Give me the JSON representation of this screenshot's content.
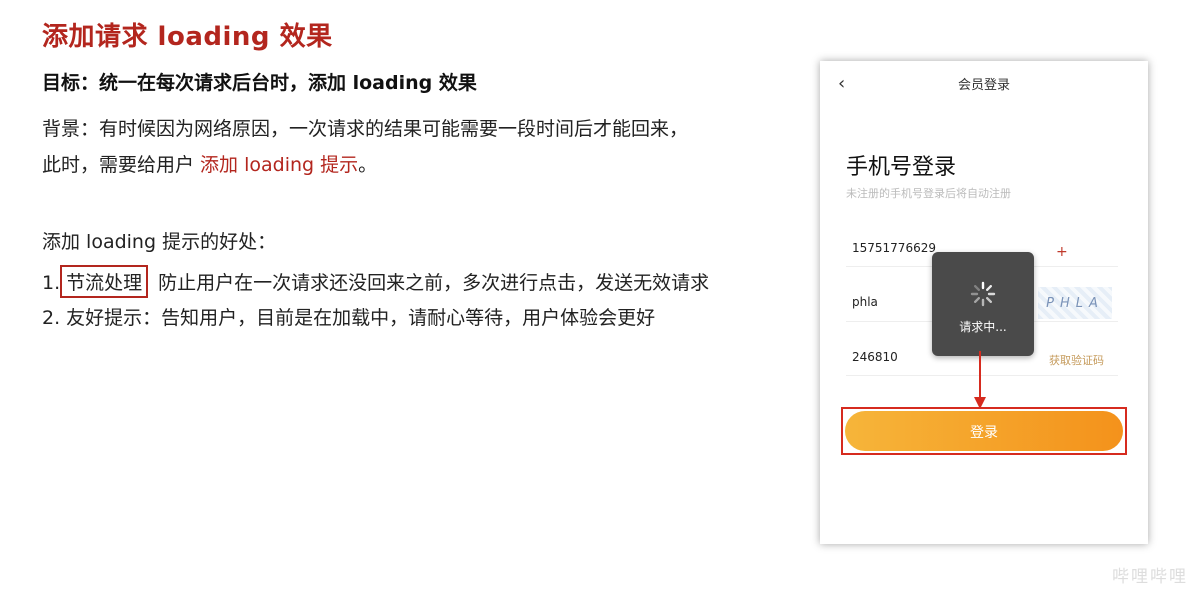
{
  "slide": {
    "title": "添加请求 loading 效果",
    "goal": "目标：统一在每次请求后台时，添加 loading 效果",
    "background_line1": "背景：有时候因为网络原因，一次请求的结果可能需要一段时间后才能回来，",
    "background_line2_prefix": "此时，需要给用户 ",
    "background_line2_highlight": "添加 loading 提示",
    "background_line2_suffix": "。",
    "benefits_title": "添加 loading 提示的好处：",
    "item1_num": "1.",
    "item1_boxed": "节流处理",
    "item1_text": "防止用户在一次请求还没回来之前，多次进行点击，发送无效请求",
    "item2_text": "2. 友好提示：告知用户，目前是在加载中，请耐心等待，用户体验会更好"
  },
  "phone": {
    "back_glyph": "‹",
    "header_title": "会员登录",
    "heading": "手机号登录",
    "subheading": "未注册的手机号登录后将自动注册",
    "phone_value": "15751776629",
    "plus": "+",
    "captcha_value": "phla",
    "captcha_image_text": "PHLA",
    "code_value": "246810",
    "get_code_label": "获取验证码",
    "loading_text": "请求中...",
    "login_label": "登录"
  },
  "watermark": "哔哩哔哩"
}
